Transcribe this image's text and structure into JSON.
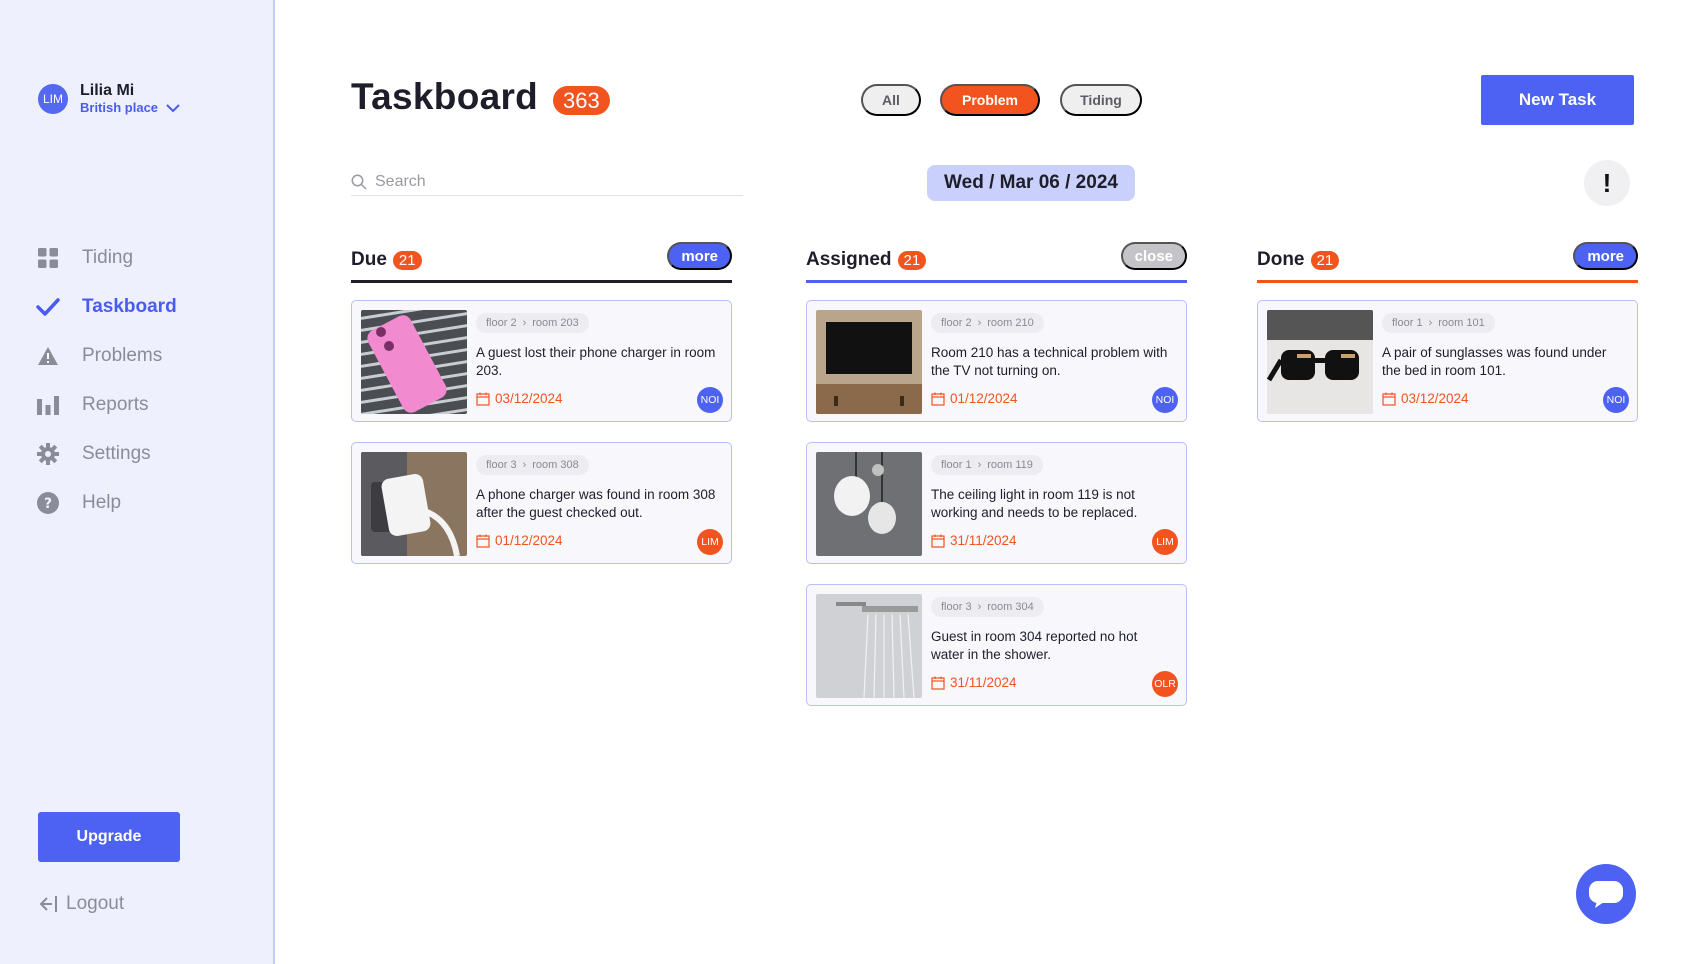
{
  "user": {
    "initials": "LIM",
    "name": "Lilia Mi",
    "place": "British place"
  },
  "sidebar": {
    "items": [
      {
        "label": "Tiding",
        "icon": "grid-icon"
      },
      {
        "label": "Taskboard",
        "icon": "check-icon"
      },
      {
        "label": "Problems",
        "icon": "warning-icon"
      },
      {
        "label": "Reports",
        "icon": "bar-chart-icon"
      },
      {
        "label": "Settings",
        "icon": "gear-icon"
      },
      {
        "label": "Help",
        "icon": "question-icon"
      }
    ],
    "upgrade_label": "Upgrade",
    "logout_label": "Logout"
  },
  "header": {
    "title": "Taskboard",
    "count": "363",
    "filters": [
      "All",
      "Problem",
      "Tiding"
    ],
    "active_filter": "Problem",
    "new_task_label": "New Task"
  },
  "search": {
    "placeholder": "Search"
  },
  "date": "Wed / Mar 06 / 2024",
  "alert_label": "!",
  "colors": {
    "accent": "#4d61f2",
    "orange": "#f2531f",
    "sidebar_bg": "#eef0fd",
    "grey_button": "#c4c4c8"
  },
  "columns": [
    {
      "title": "Due",
      "count": "21",
      "button": "more",
      "cards": [
        {
          "floor": "floor 2",
          "room": "room 203",
          "text": "A guest lost their phone charger in room 203.",
          "date": "03/12/2024",
          "assignee": "NOI",
          "image": "pink-phone"
        },
        {
          "floor": "floor 3",
          "room": "room 308",
          "text": "A phone charger was found in room 308 after the guest checked out.",
          "date": "01/12/2024",
          "assignee": "LIM",
          "image": "charger"
        }
      ]
    },
    {
      "title": "Assigned",
      "count": "21",
      "button": "close",
      "cards": [
        {
          "floor": "floor 2",
          "room": "room 210",
          "text": "Room 210 has a technical problem with the TV not turning on.",
          "date": "01/12/2024",
          "assignee": "NOI",
          "image": "tv"
        },
        {
          "floor": "floor 1",
          "room": "room 119",
          "text": "The ceiling light in room 119 is not working and needs to be replaced.",
          "date": "31/11/2024",
          "assignee": "LIM",
          "image": "ceiling-light"
        },
        {
          "floor": "floor 3",
          "room": "room 304",
          "text": "Guest in room 304 reported no hot water in the shower.",
          "date": "31/11/2024",
          "assignee": "OLR",
          "image": "shower"
        }
      ]
    },
    {
      "title": "Done",
      "count": "21",
      "button": "more",
      "cards": [
        {
          "floor": "floor 1",
          "room": "room 101",
          "text": "A pair of sunglasses was found under the bed in room 101.",
          "date": "03/12/2024",
          "assignee": "NOI",
          "image": "sunglasses"
        }
      ]
    }
  ]
}
